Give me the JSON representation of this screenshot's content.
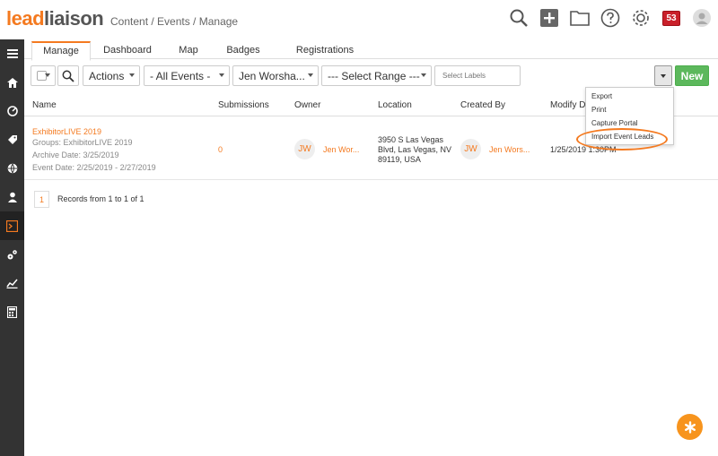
{
  "header": {
    "logo_lead": "lead",
    "logo_liaison": "liaison",
    "breadcrumb": "Content / Events / Manage",
    "notification_count": "53",
    "icons": [
      "search-icon",
      "plus-icon",
      "folder-icon",
      "help-icon",
      "gear-icon",
      "user-avatar-icon"
    ]
  },
  "sidebar": {
    "icons": [
      "menu-icon",
      "home-icon",
      "dashboard-icon",
      "tag-icon",
      "globe-icon",
      "person-icon",
      "events-icon",
      "settings-icon",
      "analytics-icon",
      "calculator-icon"
    ]
  },
  "tabs": [
    {
      "label": "Manage"
    },
    {
      "label": "Dashboard"
    },
    {
      "label": "Map"
    },
    {
      "label": "Badges"
    },
    {
      "label": "Registrations"
    }
  ],
  "toolbar": {
    "actions": "Actions",
    "events_filter": "- All Events -",
    "owner_filter": "Jen Worsha...",
    "range": "--- Select Range ---",
    "labels_placeholder": "Select Labels",
    "new_label": "New"
  },
  "table": {
    "columns": {
      "name": "Name",
      "submissions": "Submissions",
      "owner": "Owner",
      "location": "Location",
      "created_by": "Created By",
      "modify_date": "Modify Da"
    },
    "rows": [
      {
        "name": "ExhibitorLIVE 2019",
        "groups": "Groups: ExhibitorLIVE 2019",
        "archive_date": "Archive Date: 3/25/2019",
        "event_date": "Event Date: 2/25/2019 - 2/27/2019",
        "submissions": "0",
        "owner_initials": "JW",
        "owner_name": "Jen Wor...",
        "location_line1": "3950 S Las Vegas",
        "location_line2": "Blvd, Las Vegas, NV",
        "location_line3": "89119, USA",
        "creator_initials": "JW",
        "creator_name": "Jen Wors...",
        "modify_date": "1/25/2019 1:30PM"
      }
    ]
  },
  "pager": {
    "current_page": "1",
    "records_text": "Records from 1 to 1 of 1"
  },
  "dropdown": {
    "items": [
      {
        "label": "Export"
      },
      {
        "label": "Print"
      },
      {
        "label": "Capture Portal"
      },
      {
        "label": "Import Event Leads"
      }
    ]
  },
  "colors": {
    "accent": "#f47a20",
    "sidebar": "#333333",
    "new_button": "#5cb85c",
    "badge": "#c9202a"
  }
}
